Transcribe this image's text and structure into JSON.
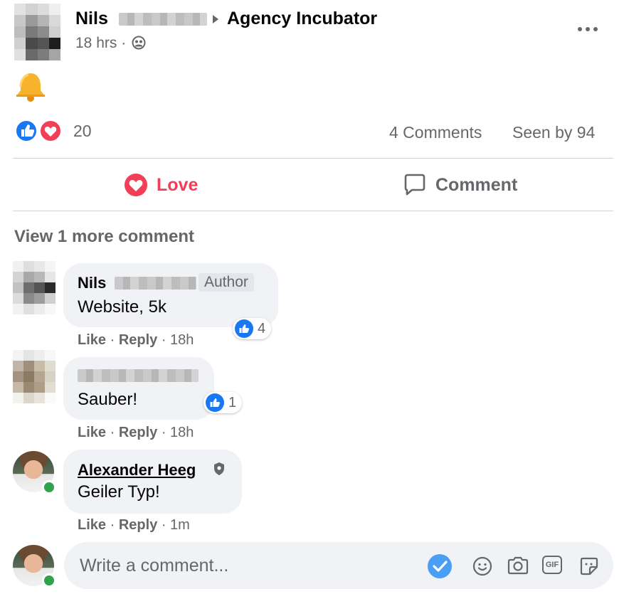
{
  "post": {
    "author": "Nils",
    "group": "Agency Incubator",
    "time": "18 hrs ·",
    "reaction_count": "20",
    "comments_count": "4 Comments",
    "seen_by": "Seen by 94",
    "body_emoji": "🔔"
  },
  "actions": {
    "love_label": "Love",
    "comment_label": "Comment"
  },
  "view_more": "View 1 more comment",
  "comments": [
    {
      "author": "Nils",
      "badge": "Author",
      "text": "Website, 5k",
      "like": "Like",
      "reply": "Reply",
      "time": "· 18h",
      "reaction_count": "4"
    },
    {
      "author": "",
      "text": "Sauber!",
      "like": "Like",
      "reply": "Reply",
      "time": "· 18h",
      "reaction_count": "1"
    },
    {
      "author": "Alexander Heeg",
      "text": "Geiler Typ!",
      "like": "Like",
      "reply": "Reply",
      "time": "· 1m"
    }
  ],
  "composer": {
    "placeholder": "Write a comment...",
    "gif_label": "GIF"
  },
  "colors": {
    "love_red": "#f33e58",
    "like_blue": "#1877f2",
    "muted_text": "#65676b",
    "bubble_bg": "#f0f2f5",
    "online_green": "#31a24c"
  },
  "icons": [
    "like-reaction-icon",
    "love-reaction-icon",
    "more-options-icon",
    "privacy-icon",
    "comment-icon",
    "emoji-icon",
    "camera-icon",
    "gif-icon",
    "sticker-icon",
    "send-check-icon",
    "verified-shield-icon"
  ]
}
